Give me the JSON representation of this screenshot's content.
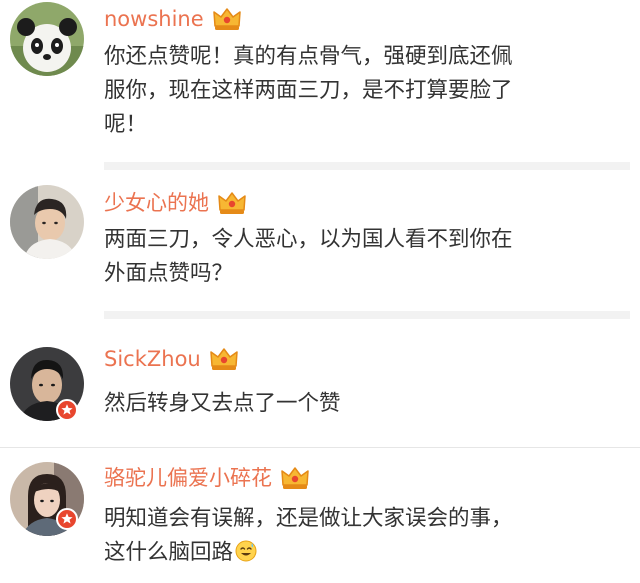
{
  "comments": [
    {
      "username": "nowshine",
      "avatar_icon": "panda-avatar",
      "badge_icon": "crown-icon",
      "lines": [
        "你还点赞呢！真的有点骨气，强硬到底还佩",
        "服你，现在这样两面三刀，是不打算要脸了",
        "呢！"
      ]
    },
    {
      "username": "少女心的她",
      "avatar_icon": "person-avatar",
      "badge_icon": "crown-icon",
      "lines": [
        "两面三刀，令人恶心，以为国人看不到你在",
        "外面点赞吗？"
      ]
    },
    {
      "username": "SickZhou",
      "avatar_icon": "person-avatar",
      "badge_icon": "crown-icon",
      "verified_icon": "verified-star-icon",
      "lines": [
        "然后转身又去点了一个赞"
      ]
    },
    {
      "username": "骆驼儿偏爱小碎花",
      "avatar_icon": "person-avatar",
      "badge_icon": "crown-icon",
      "verified_icon": "verified-star-icon",
      "lines": [
        "明知道会有误解，还是做让大家误会的事，",
        "这什么脑回路"
      ],
      "trailing_emoji": "sweat-smile-emoji"
    }
  ],
  "colors": {
    "username": "#eb7350",
    "text": "#333333",
    "divider": "#f2f2f2",
    "verified": "#e8462e"
  }
}
